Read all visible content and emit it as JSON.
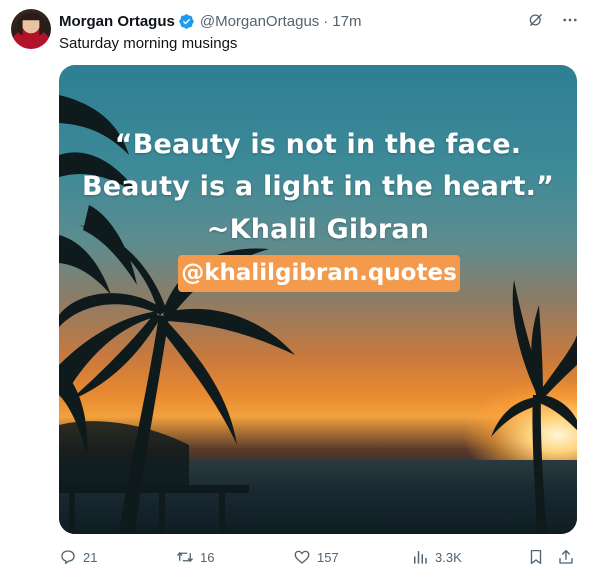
{
  "post": {
    "author_name": "Morgan Ortagus",
    "handle": "@MorganOrtagus",
    "separator": "·",
    "time": "17m",
    "text": "Saturday morning musings"
  },
  "media": {
    "quote_line_1": "“Beauty is not in the face.",
    "quote_line_2": "Beauty is a light in the heart.”",
    "quote_line_3": "~Khalil Gibran",
    "tag": "@khalilgibran.quotes"
  },
  "actions": {
    "replies": "21",
    "reposts": "16",
    "likes": "157",
    "views": "3.3K"
  },
  "icons": {
    "top": [
      "grok-icon",
      "more-icon"
    ],
    "actions": [
      "reply-icon",
      "repost-icon",
      "like-icon",
      "views-icon",
      "bookmark-icon",
      "share-icon"
    ]
  },
  "colors": {
    "verified": "#1d9bf0",
    "secondary_text": "#536471",
    "tag_background": "#f39a4c"
  }
}
